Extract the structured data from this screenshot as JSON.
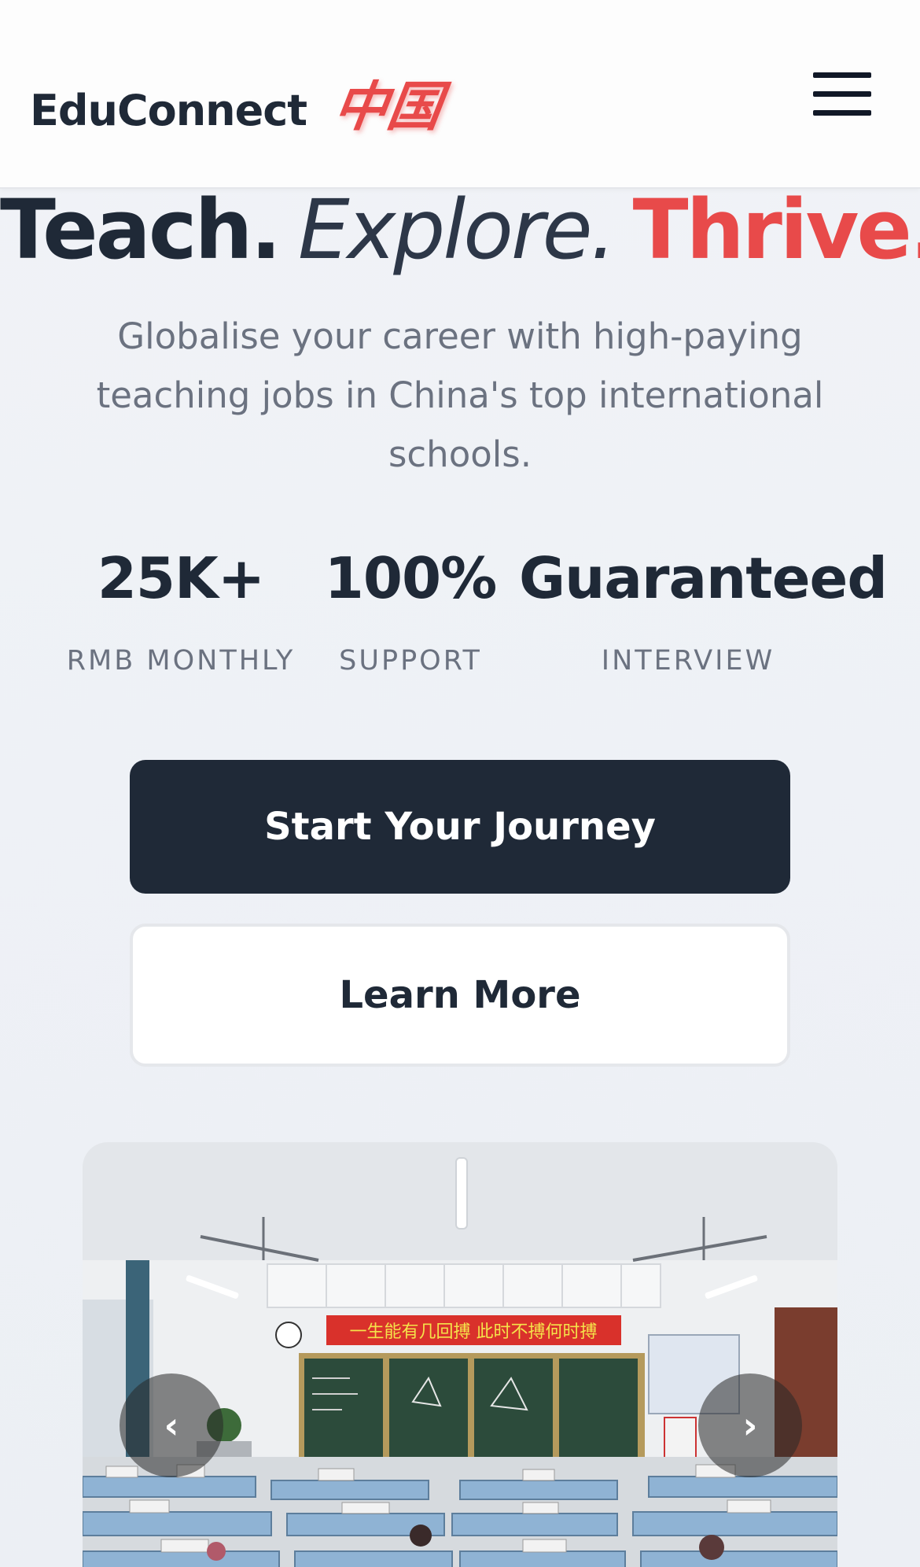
{
  "header": {
    "brand_name": "EduConnect",
    "brand_mark": "中国",
    "menu_icon": "hamburger-menu-icon"
  },
  "hero": {
    "headline_word_1": "Teach.",
    "headline_word_2": "Explore.",
    "headline_word_3": "Thrive.",
    "subtitle": "Globalise your career with high-paying teaching jobs in China's top international schools."
  },
  "stats": [
    {
      "value": "25K+",
      "label": "RMB MONTHLY"
    },
    {
      "value": "100%",
      "label": "SUPPORT"
    },
    {
      "value": "Guaranteed",
      "label": "INTERVIEW"
    }
  ],
  "actions": {
    "primary_label": "Start Your Journey",
    "secondary_label": "Learn More"
  },
  "carousel": {
    "banner_text": "一生能有几回搏  此时不搏何时搏",
    "prev_icon": "‹",
    "next_icon": "›"
  },
  "colors": {
    "accent": "#e84a4a",
    "dark": "#1f2937",
    "muted": "#6b7280"
  }
}
